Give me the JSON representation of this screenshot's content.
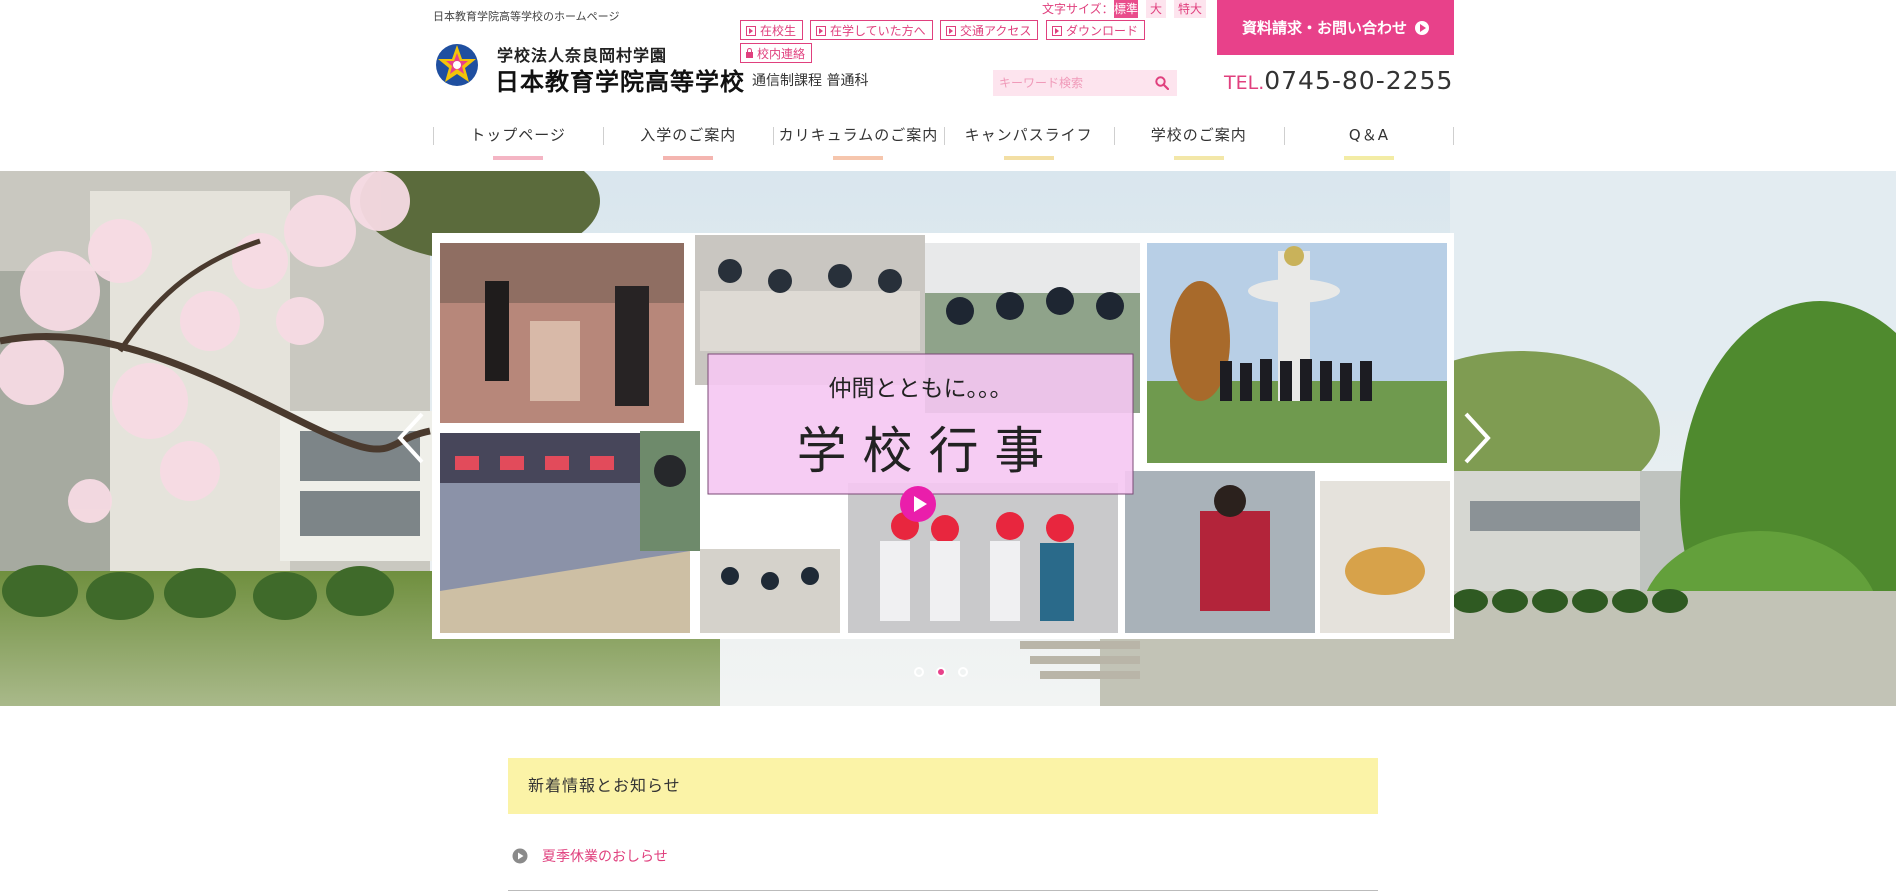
{
  "header": {
    "tagline": "日本教育学院高等学校のホームページ",
    "school_sub": "学校法人奈良岡村学園",
    "school_main": "日本教育学院高等学校",
    "course": "通信制課程 普通科",
    "font_size": {
      "label": "文字サイズ：",
      "standard": "標準",
      "large": "大",
      "xlarge": "特大"
    },
    "quick_links": [
      "在校生",
      "在学していた方へ",
      "交通アクセス",
      "ダウンロード"
    ],
    "internal_link": "校内連絡",
    "contact_button": "資料請求・お問い合わせ",
    "search_placeholder": "キーワード検索",
    "tel_label": "TEL.",
    "tel_number": "0745-80-2255"
  },
  "nav": {
    "items": [
      {
        "label": "トップページ",
        "color": "#f4b5c4"
      },
      {
        "label": "入学のご案内",
        "color": "#f4b5b0"
      },
      {
        "label": "カリキュラムのご案内",
        "color": "#f6c6ad"
      },
      {
        "label": "キャンパスライフ",
        "color": "#f3dfa4"
      },
      {
        "label": "学校のご案内",
        "color": "#f3e7a8"
      },
      {
        "label": "Q＆A",
        "color": "#f3eca5"
      }
    ]
  },
  "hero": {
    "subtitle": "仲間とともに。。。",
    "title": "学 校 行 事",
    "slide_count": 3,
    "active_slide": 2
  },
  "news": {
    "heading": "新着情報とお知らせ",
    "items": [
      "夏季休業のおしらせ"
    ]
  },
  "colors": {
    "accent": "#e8418a",
    "news_bg": "#fbf3a7"
  }
}
